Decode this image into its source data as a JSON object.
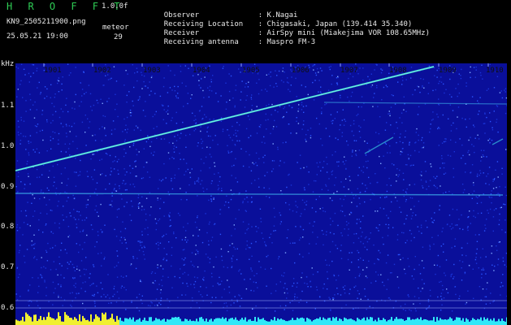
{
  "header": {
    "logo": "H R O F F T",
    "version": "1.0.0f",
    "filename": "KN9_2505211900.png",
    "meteor_label": "meteor",
    "meteor_count": "29",
    "timestamp": "25.05.21 19:00"
  },
  "info": [
    {
      "label": "Observer",
      "value": ": K.Nagai"
    },
    {
      "label": "Receiving Location",
      "value": ": Chigasaki, Japan (139.414 35.340)"
    },
    {
      "label": "Receiver",
      "value": ": AirSpy mini (Miakejima VOR 108.65MHz)"
    },
    {
      "label": "Receiving antenna",
      "value": ": Maspro FM-3"
    }
  ],
  "y_axis": {
    "unit": "kHz",
    "ticks": [
      "1.1",
      "1.0",
      "0.9",
      "0.8",
      "0.7",
      "0.6"
    ]
  },
  "x_axis": {
    "ticks": [
      "1901",
      "1902",
      "1903",
      "1904",
      "1905",
      "1906",
      "1907",
      "1908",
      "1909",
      "1910"
    ]
  },
  "colors": {
    "background": "#000000",
    "spectrogram_bg": "#0a0f9a",
    "noise": "#2a54ff",
    "trace": "#38d8d0",
    "logo_green": "#2ecc55",
    "scale_bar": "#f0f030",
    "scale_bar_cyan": "#30e8f8"
  }
}
